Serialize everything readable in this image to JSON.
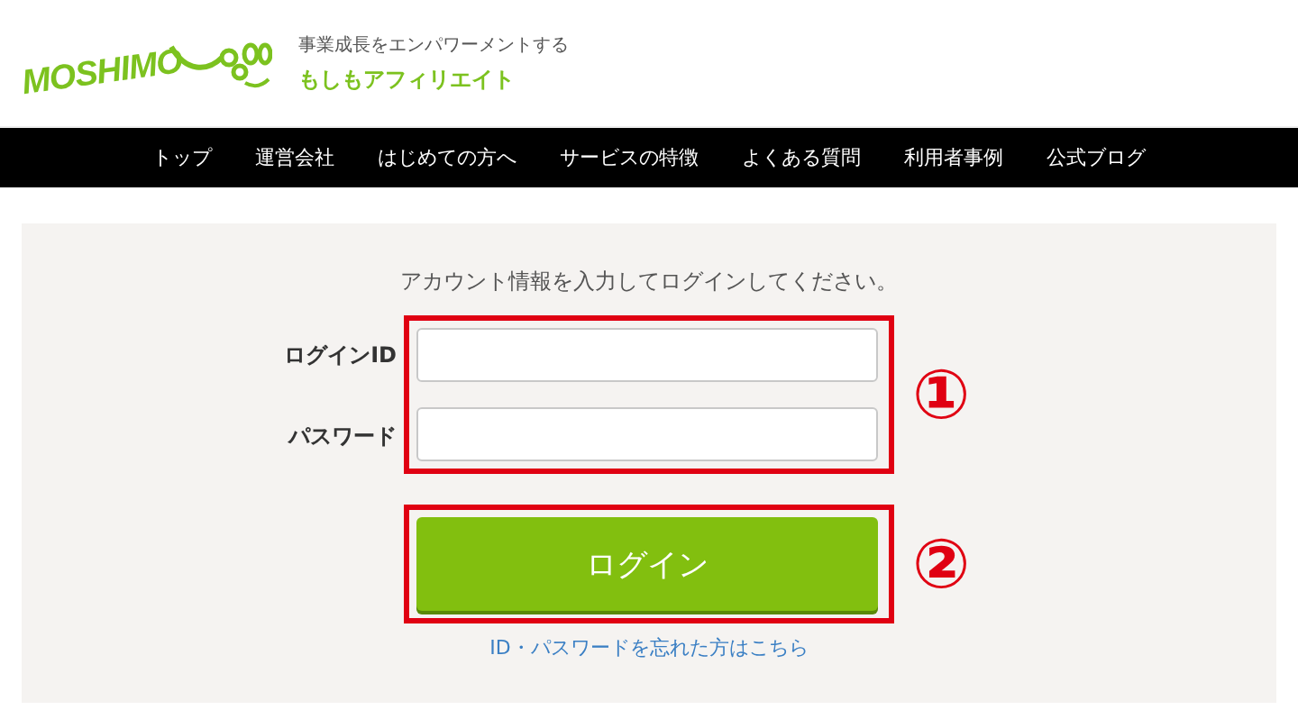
{
  "header": {
    "logo_text": "MOSHIMO",
    "tagline": "事業成長をエンパワーメントする",
    "brand": "もしもアフィリエイト"
  },
  "nav": [
    "トップ",
    "運営会社",
    "はじめての方へ",
    "サービスの特徴",
    "よくある質問",
    "利用者事例",
    "公式ブログ"
  ],
  "form": {
    "message": "アカウント情報を入力してログインしてください。",
    "fields": [
      {
        "label": "ログインID"
      },
      {
        "label": "パスワード"
      }
    ],
    "button": "ログイン",
    "forgot_link": "ID・パスワードを忘れた方はこちら"
  },
  "annotations": [
    "①",
    "②"
  ]
}
